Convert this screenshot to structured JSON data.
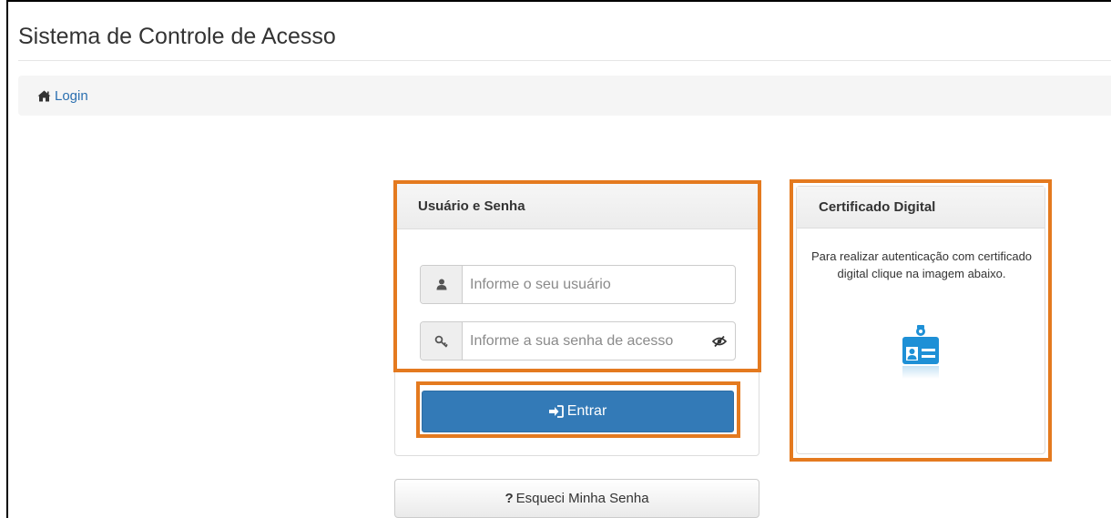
{
  "header": {
    "title": "Sistema de Controle de Acesso"
  },
  "breadcrumb": {
    "items": [
      {
        "label": "Login",
        "icon": "home-icon"
      }
    ]
  },
  "login_panel": {
    "title": "Usuário e Senha",
    "username": {
      "placeholder": "Informe o seu usuário",
      "value": "",
      "icon": "user-icon"
    },
    "password": {
      "placeholder": "Informe a sua senha de acesso",
      "value": "",
      "icon": "key-icon",
      "toggle_icon": "eye-slash-icon"
    },
    "submit": {
      "label": "Entrar",
      "icon": "sign-in-icon"
    }
  },
  "forgot": {
    "label": "Esqueci Minha Senha",
    "icon": "question-icon"
  },
  "cert_panel": {
    "title": "Certificado Digital",
    "description": "Para realizar autenticação com certificado digital clique na imagem abaixo.",
    "image_icon": "id-card-icon"
  },
  "colors": {
    "primary_button": "#337ab7",
    "link": "#2a6fb0",
    "highlight": "#e47a1f",
    "id_card": "#1e90d6"
  }
}
